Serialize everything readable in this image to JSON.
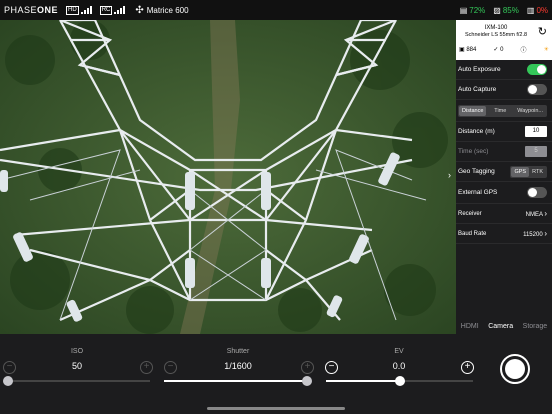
{
  "topbar": {
    "brand_light": "PHASE",
    "brand_bold": "ONE",
    "signal1_tag": "HD",
    "signal2_tag": "RC",
    "drone_icon": "drone-icon",
    "drone_name": "Matrice 600",
    "stats": [
      {
        "icon": "camera-status-icon",
        "value": "72%",
        "color": "#34c759"
      },
      {
        "icon": "drone-battery-icon",
        "value": "85%",
        "color": "#34c759"
      },
      {
        "icon": "controller-battery-icon",
        "value": "0%",
        "color": "#ff3b30"
      }
    ]
  },
  "panel": {
    "camera_model": "IXM-100",
    "lens": "Schneider LS 55mm f/2.8",
    "shot_count": "884",
    "error_count": "0",
    "auto_exposure_label": "Auto Exposure",
    "auto_exposure_on": true,
    "auto_capture_label": "Auto Capture",
    "auto_capture_on": false,
    "capture_modes": [
      "Distance",
      "Time",
      "Waypoin..."
    ],
    "capture_mode_selected": "Distance",
    "distance_label": "Distance (m)",
    "distance_value": "10",
    "time_label": "Time (sec)",
    "time_value": "5",
    "geotag_label": "Geo Tagging",
    "geotag_options": [
      "GPS",
      "RTK"
    ],
    "geotag_selected": "GPS",
    "external_gps_label": "External GPS",
    "external_gps_on": false,
    "receiver_label": "Receiver",
    "receiver_value": "NMEA",
    "baud_label": "Baud Rate",
    "baud_value": "115200",
    "tabs": [
      "HDMI",
      "Camera",
      "Storage"
    ],
    "tab_active": "Camera"
  },
  "controls": {
    "iso_label": "ISO",
    "iso_value": "50",
    "iso_slider": 0.0,
    "shutter_label": "Shutter",
    "shutter_value": "1/1600",
    "shutter_slider": 1.0,
    "ev_label": "EV",
    "ev_value": "0.0",
    "ev_slider": 0.5
  }
}
